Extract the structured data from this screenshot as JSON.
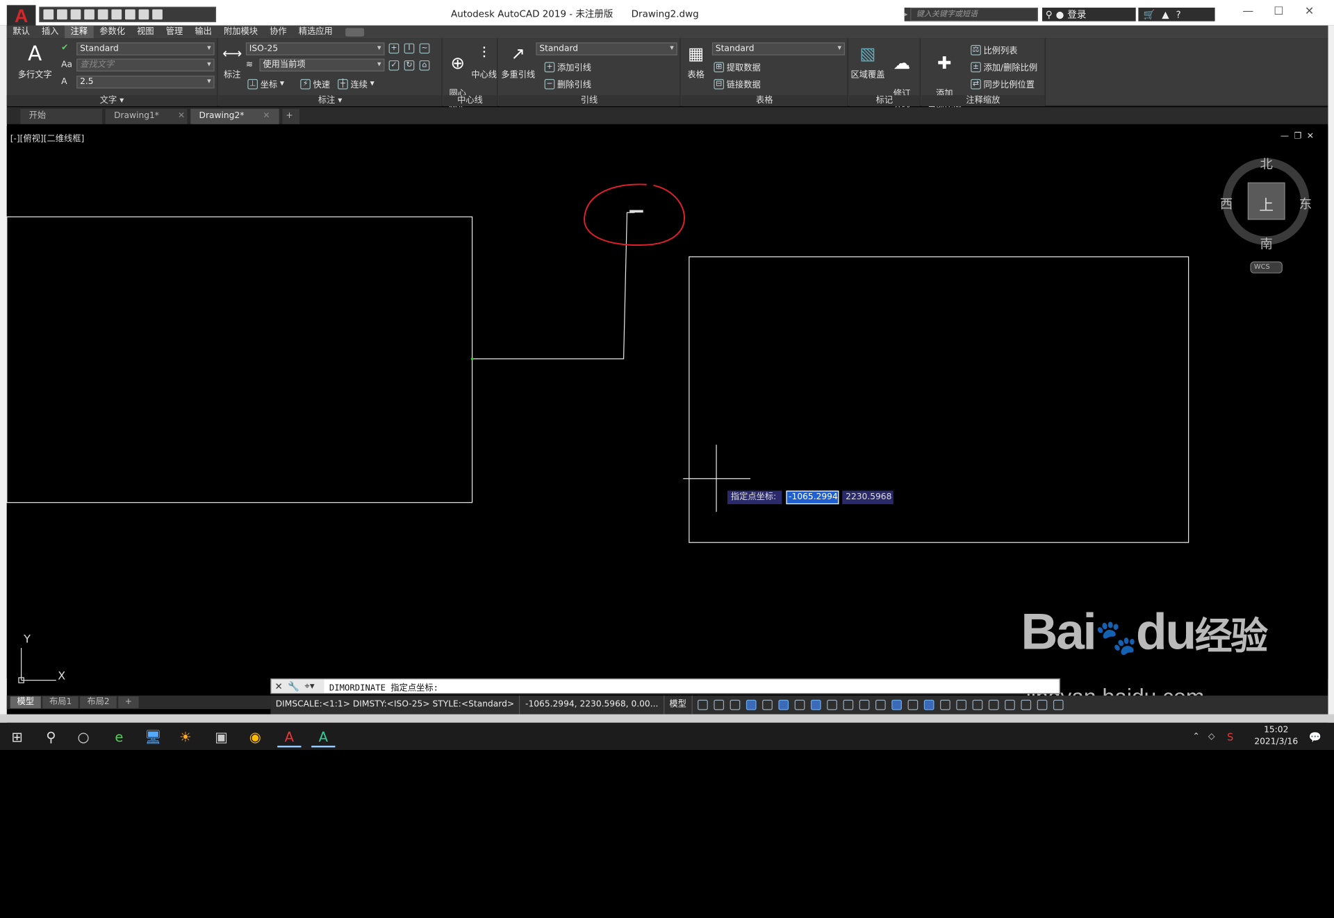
{
  "window": {
    "title": "Autodesk AutoCAD 2019 - 未注册版",
    "filename": "Drawing2.dwg",
    "search_placeholder": "键入关键字或短语",
    "login": "登录"
  },
  "ribbon_tabs": [
    "默认",
    "插入",
    "注释",
    "参数化",
    "视图",
    "管理",
    "输出",
    "附加模块",
    "协作",
    "精选应用"
  ],
  "active_ribbon_tab": "注释",
  "panels": {
    "text": {
      "title": "文字",
      "multiline_text": "多行文字",
      "style": "Standard",
      "find_placeholder": "查找文字",
      "height": "2.5"
    },
    "dimensions": {
      "title": "标注",
      "dimension": "标注",
      "dim_style": "ISO-25",
      "layer": "使用当前项",
      "ordinate": "坐标",
      "quick": "快速",
      "continue": "连续"
    },
    "centerline": {
      "title": "中心线",
      "center_mark": "圆心\n标记",
      "center_line": "中心线"
    },
    "leaders": {
      "title": "引线",
      "multileader": "多重引线",
      "style": "Standard",
      "add_leader": "添加引线",
      "remove_leader": "删除引线"
    },
    "tables": {
      "title": "表格",
      "table": "表格",
      "style": "Standard",
      "extract_data": "提取数据",
      "link_data": "链接数据"
    },
    "markup": {
      "title": "标记",
      "wipeout": "区域覆盖",
      "revcloud": "修订\n云线"
    },
    "annotation_scaling": {
      "title": "注释缩放",
      "add_current_scale": "添加\n当前比例",
      "scale_list": "比例列表",
      "add_delete_scales": "添加/删除比例",
      "sync_scale_positions": "同步比例位置"
    }
  },
  "doc_tabs": [
    {
      "label": "开始",
      "active": false
    },
    {
      "label": "Drawing1*",
      "active": false
    },
    {
      "label": "Drawing2*",
      "active": true
    }
  ],
  "viewport": {
    "label": "[-][俯视][二维线框]",
    "compass": {
      "north": "北",
      "south": "南",
      "east": "东",
      "west": "西",
      "top": "上"
    },
    "wcs": "WCS",
    "ucs_x": "X",
    "ucs_y": "Y"
  },
  "dynamic_input": {
    "prompt": "指定点坐标:",
    "x_value": "-1065.2994",
    "y_value": "2230.5968"
  },
  "command_line": {
    "text": "DIMORDINATE 指定点坐标:"
  },
  "layout_tabs": [
    {
      "label": "模型",
      "active": true
    },
    {
      "label": "布局1",
      "active": false
    },
    {
      "label": "布局2",
      "active": false
    }
  ],
  "status_bar": {
    "dim_info": "DIMSCALE:<1:1> DIMSTY:<ISO-25> STYLE:<Standard>",
    "coords": "-1065.2994, 2230.5968, 0.00...",
    "model": "模型"
  },
  "taskbar": {
    "time": "15:02",
    "date": "2021/3/16"
  },
  "watermark": {
    "brand": "Bai",
    "brand_du": "du",
    "brand_cn": "经验",
    "url": "jingyan.baidu.com"
  },
  "colors": {
    "accent": "#d6262b",
    "ribbon_bg": "#3b3b3b",
    "selection": "#1f5fd0",
    "annotation_circle": "#e0202a"
  }
}
